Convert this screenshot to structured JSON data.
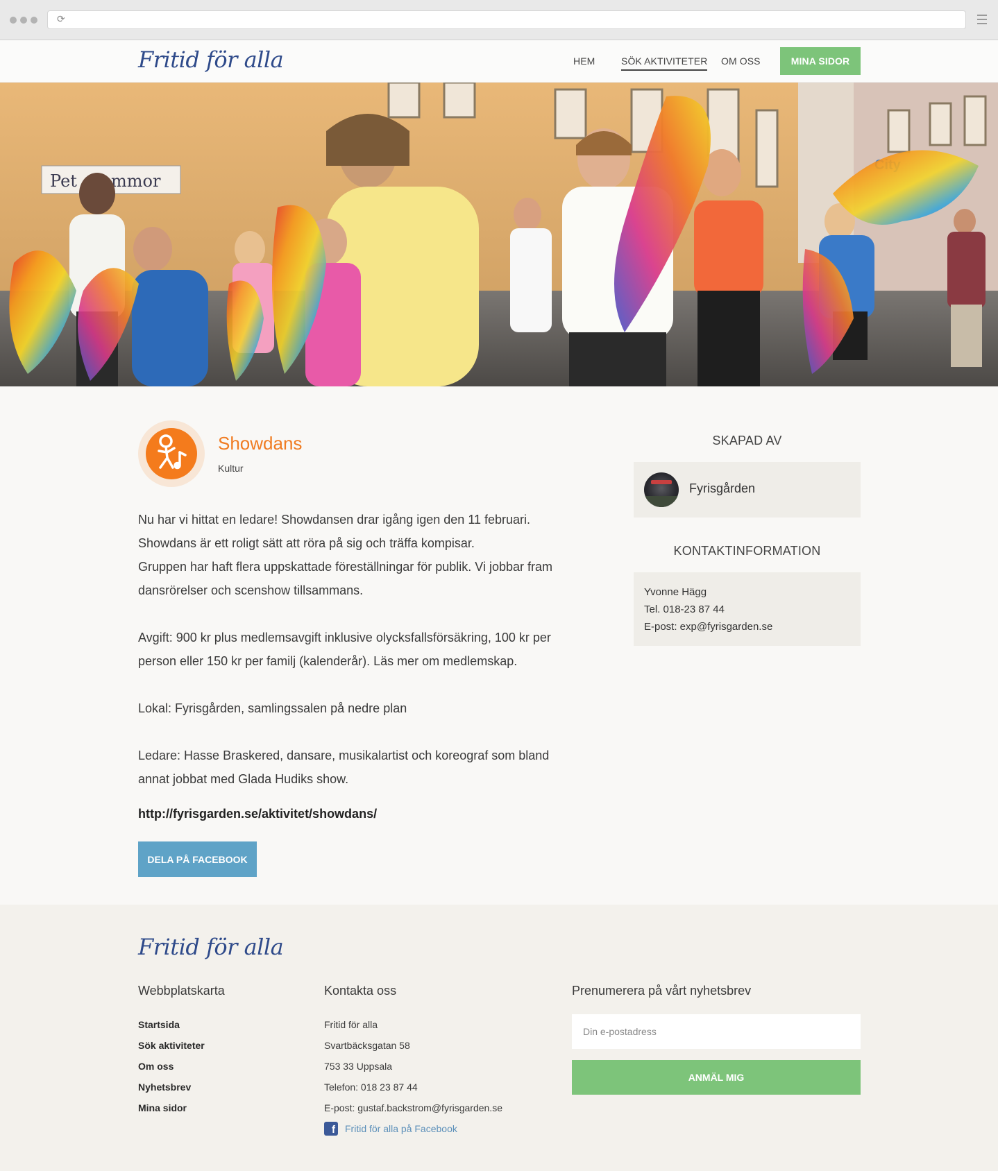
{
  "browser": {
    "url": ""
  },
  "header": {
    "logo_text": "Fritid för alla",
    "nav": [
      "HEM",
      "SÖK AKTIVITETER",
      "OM OSS"
    ],
    "active_nav": "SÖK AKTIVITETER",
    "mina_sidor": "MINA SIDOR"
  },
  "activity": {
    "title": "Showdans",
    "category": "Kultur",
    "description": [
      "Nu har vi hittat en ledare! Showdansen drar igång igen den 11 februari.",
      "Showdans är ett roligt sätt att röra på sig och träffa kompisar.",
      "Gruppen har haft flera uppskattade föreställningar för publik. Vi jobbar fram dansrörelser och scenshow tillsammans.",
      "Avgift: 900 kr plus medlemsavgift inklusive olycksfallsförsäkring, 100 kr per person eller 150 kr per familj (kalenderår). Läs mer om medlemskap.",
      "Lokal: Fyrisgården, samlingssalen på nedre plan",
      "Ledare: Hasse Braskered, dansare, musikalartist och koreograf som bland annat jobbat med Glada Hudiks show."
    ],
    "url": "http://fyrisgarden.se/aktivitet/showdans/",
    "share_button": "DELA PÅ FACEBOOK",
    "icon": "dance-music-icon",
    "accent_color": "#f47b1c"
  },
  "sidebar": {
    "created_by_heading": "SKAPAD AV",
    "creator_name": "Fyrisgården",
    "contact_heading": "KONTAKTINFORMATION",
    "contact": {
      "name": "Yvonne Hägg",
      "phone": "Tel. 018-23 87 44",
      "email": "E-post: exp@fyrisgarden.se"
    }
  },
  "footer": {
    "logo_text": "Fritid för alla",
    "sitemap_heading": "Webbplatskarta",
    "sitemap_links": [
      "Startsida",
      "Sök aktiviteter",
      "Om oss",
      "Nyhetsbrev",
      "Mina sidor"
    ],
    "contact_heading": "Kontakta oss",
    "contact_lines": [
      "Fritid för alla",
      "Svartbäcksgatan 58",
      "753 33 Uppsala",
      "Telefon: 018 23 87 44",
      "E-post: gustaf.backstrom@fyrisgarden.se"
    ],
    "facebook_link": "Fritid för alla på Facebook",
    "newsletter_heading": "Prenumerera på vårt nyhetsbrev",
    "email_placeholder": "Din e-postadress",
    "signup_button": "ANMÄL MIG"
  },
  "colors": {
    "green": "#7dc47a",
    "blue_button": "#5fa3c7",
    "orange": "#f07c22",
    "logo_blue": "#2e4a8a"
  }
}
